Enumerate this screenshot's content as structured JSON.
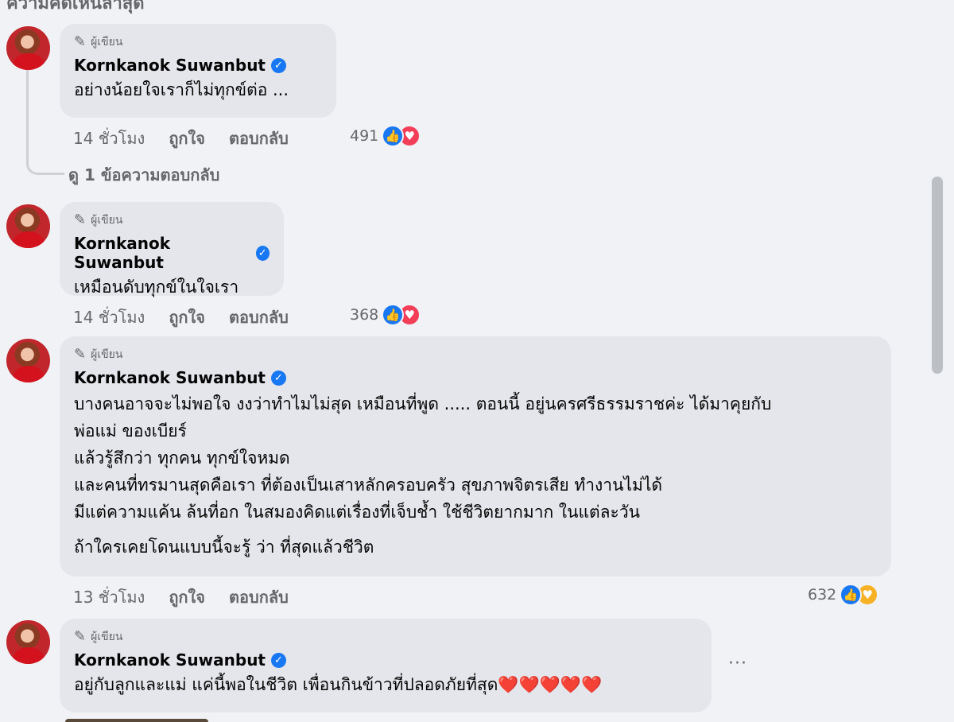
{
  "top_partial_text": "ความคิดเห็นล่าสุด",
  "author_tag": "ผู้เขียน",
  "view_replies": "ดู 1 ข้อความตอบกลับ",
  "actions": {
    "like": "ถูกใจ",
    "reply": "ตอบกลับ"
  },
  "more_options": "···",
  "comments": [
    {
      "name": "Kornkanok Suwanbut",
      "lines": [
        "อย่างน้อยใจเราก็ไม่ทุกข์ต่อ ..."
      ],
      "time": "14 ชั่วโมง",
      "reaction_count": "491",
      "reactions": [
        "like-icon",
        "love-icon"
      ]
    },
    {
      "name": "Kornkanok Suwanbut",
      "lines": [
        "เหมือนดับทุกข์ในใจเรา"
      ],
      "time": "14 ชั่วโมง",
      "reaction_count": "368",
      "reactions": [
        "like-icon",
        "love-icon"
      ]
    },
    {
      "name": "Kornkanok Suwanbut",
      "lines": [
        "บางคนอาจจะไม่พอใจ งงว่าทำไมไม่สุด เหมือนที่พูด ..... ตอนนี้ อยู่นครศรีธรรมราชค่ะ ได้มาคุยกับ",
        "พ่อแม่ ของเบียร์",
        "แล้วรู้สึกว่า ทุกคน ทุกข์ใจหมด",
        "และคนที่ทรมานสุดคือเรา ที่ต้องเป็นเสาหลักครอบครัว สุขภาพจิตรเสีย ทำงานไม่ได้",
        "มีแต่ความแค้น ล้นที่อก ในสมองคิดแต่เรื่องที่เจ็บช้ำ ใช้ชีวิตยากมาก ในแต่ละวัน",
        "ถ้าใครเคยโดนแบบนี้จะรู้ ว่า ที่สุดแล้วชีวิต"
      ],
      "time": "13 ชั่วโมง",
      "reaction_count": "632",
      "reactions": [
        "like-icon",
        "care-icon"
      ]
    },
    {
      "name": "Kornkanok Suwanbut",
      "lines": [
        "อยู่กับลูกและแม่ แค่นี้พอในชีวิต เพื่อนกินข้าวที่ปลอดภัยที่สุด❤️❤️❤️❤️❤️"
      ]
    }
  ]
}
